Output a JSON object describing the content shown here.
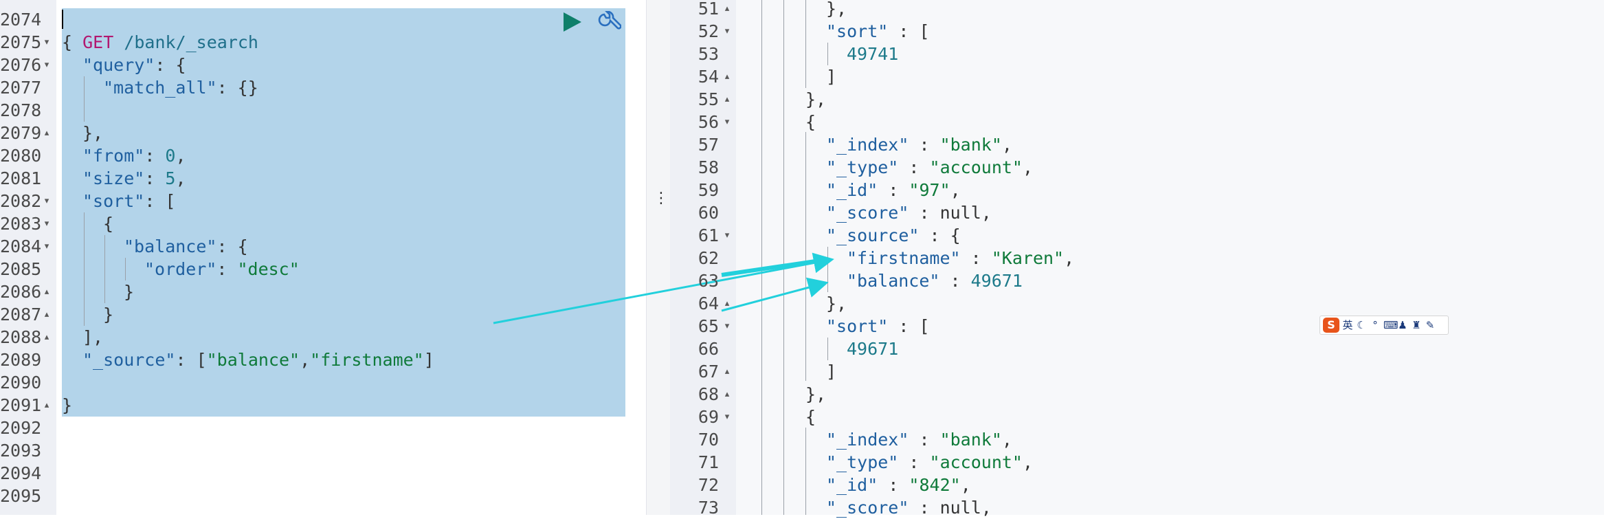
{
  "request": {
    "method": "GET",
    "path": " /bank/_search"
  },
  "left_line_numbers": [
    "2074",
    "2075",
    "2076",
    "2077",
    "2078",
    "2079",
    "2080",
    "2081",
    "2082",
    "2083",
    "2084",
    "2085",
    "2086",
    "2087",
    "2088",
    "2089",
    "2090",
    "2091",
    "2092",
    "2093",
    "2094",
    "2095"
  ],
  "left_folds": [
    "",
    "▾",
    "▾",
    "",
    "",
    "▴",
    "",
    "",
    "▾",
    "▾",
    "▾",
    "",
    "▴",
    "▴",
    "▴",
    "",
    "",
    "▴",
    "",
    "",
    "",
    ""
  ],
  "right_line_numbers": [
    "51",
    "52",
    "53",
    "54",
    "55",
    "56",
    "57",
    "58",
    "59",
    "60",
    "61",
    "62",
    "63",
    "64",
    "65",
    "66",
    "67",
    "68",
    "69",
    "70",
    "71",
    "72",
    "73"
  ],
  "right_folds": [
    "▴",
    "▾",
    "",
    "▴",
    "▴",
    "▾",
    "",
    "",
    "",
    "",
    "▾",
    "",
    "",
    "▴",
    "▾",
    "",
    "▴",
    "▴",
    "▾",
    "",
    "",
    "",
    ""
  ],
  "request_body": {
    "l2075": "{",
    "l2076_key": "\"query\"",
    "l2076_rest": ": {",
    "l2077_key": "\"match_all\"",
    "l2077_rest": ": {}",
    "l2079": "},",
    "l2080_key": "\"from\"",
    "l2080_val": "0",
    "l2081_key": "\"size\"",
    "l2081_val": "5",
    "l2082_key": "\"sort\"",
    "l2082_rest": ": [",
    "l2083": "{",
    "l2084_key": "\"balance\"",
    "l2084_rest": ": {",
    "l2085_key": "\"order\"",
    "l2085_val": "\"desc\"",
    "l2086": "}",
    "l2087": "}",
    "l2088": "],",
    "l2089_key": "\"_source\"",
    "l2089_open": ": [",
    "l2089_v1": "\"balance\"",
    "l2089_comma": ",",
    "l2089_v2": "\"firstname\"",
    "l2089_close": "]",
    "l2091": "}"
  },
  "response": {
    "l51": "},",
    "l52_key": "\"sort\"",
    "l52_rest": " : [",
    "l53": "49741",
    "l54": "]",
    "l55": "},",
    "l56": "{",
    "l57_key": "\"_index\"",
    "l57_val": "\"bank\"",
    "l58_key": "\"_type\"",
    "l58_val": "\"account\"",
    "l59_key": "\"_id\"",
    "l59_val": "\"97\"",
    "l60_key": "\"_score\"",
    "l60_val": "null",
    "l61_key": "\"_source\"",
    "l61_rest": " : {",
    "l62_key": "\"firstname\"",
    "l62_val": "\"Karen\"",
    "l63_key": "\"balance\"",
    "l63_val": "49671",
    "l64": "},",
    "l65_key": "\"sort\"",
    "l65_rest": " : [",
    "l66": "49671",
    "l67": "]",
    "l68": "},",
    "l69": "{",
    "l70_key": "\"_index\"",
    "l70_val": "\"bank\"",
    "l71_key": "\"_type\"",
    "l71_val": "\"account\"",
    "l72_key": "\"_id\"",
    "l72_val": "\"842\"",
    "l73_key": "\"_score\"",
    "l73_val": "null"
  },
  "ime": {
    "logo": "S",
    "lang": "英"
  },
  "colors": {
    "selection": "#b3d4ea",
    "run_button": "#0f7f6a",
    "annotation_arrow": "#22d0dc"
  },
  "icons": [
    "run-icon",
    "wrench-icon",
    "divider-dots-icon",
    "ime-logo-icon"
  ]
}
